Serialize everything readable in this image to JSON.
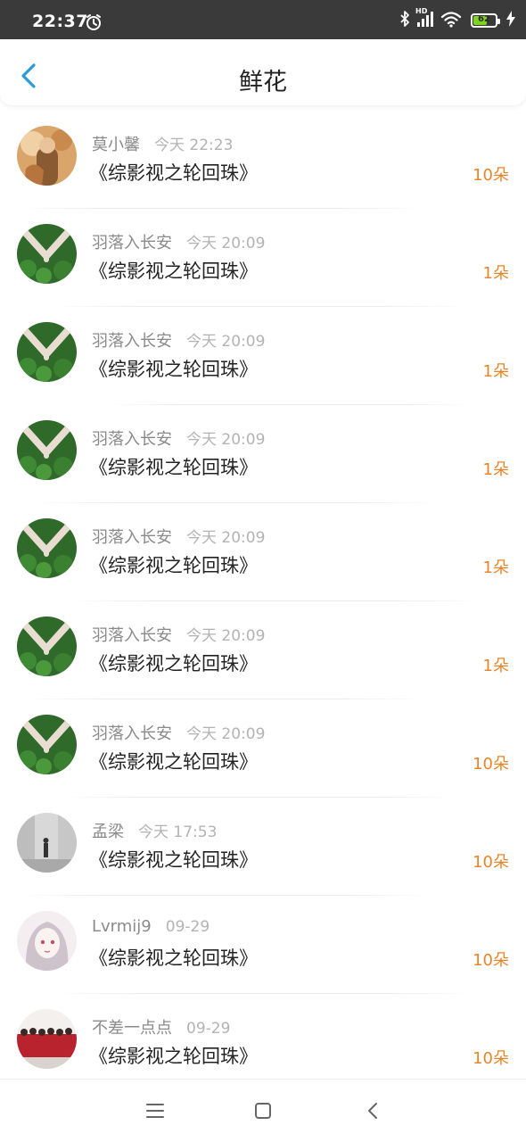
{
  "status_bar": {
    "time": "22:37",
    "hd_label": "HD",
    "battery_level": "62",
    "battery_percent": 62,
    "icons": [
      "alarm-icon",
      "bluetooth-icon",
      "signal-icon",
      "wifi-icon",
      "battery-icon",
      "charging-icon"
    ]
  },
  "header": {
    "title": "鲜花",
    "back_icon": "chevron-left-icon"
  },
  "colors": {
    "accent": "#2b9ad8",
    "amount": "#e8852a",
    "status_bar_bg": "#3a3a3a"
  },
  "items": [
    {
      "name": "莫小馨",
      "time": "今天 22:23",
      "title": "《综影视之轮回珠》",
      "amount": "10朵",
      "avatar": "warm-portrait"
    },
    {
      "name": "羽落入长安",
      "time": "今天 20:09",
      "title": "《综影视之轮回珠》",
      "amount": "1朵",
      "avatar": "heart-hands-grass"
    },
    {
      "name": "羽落入长安",
      "time": "今天 20:09",
      "title": "《综影视之轮回珠》",
      "amount": "1朵",
      "avatar": "heart-hands-grass"
    },
    {
      "name": "羽落入长安",
      "time": "今天 20:09",
      "title": "《综影视之轮回珠》",
      "amount": "1朵",
      "avatar": "heart-hands-grass"
    },
    {
      "name": "羽落入长安",
      "time": "今天 20:09",
      "title": "《综影视之轮回珠》",
      "amount": "1朵",
      "avatar": "heart-hands-grass"
    },
    {
      "name": "羽落入长安",
      "time": "今天 20:09",
      "title": "《综影视之轮回珠》",
      "amount": "1朵",
      "avatar": "heart-hands-grass"
    },
    {
      "name": "羽落入长安",
      "time": "今天 20:09",
      "title": "《综影视之轮回珠》",
      "amount": "10朵",
      "avatar": "heart-hands-grass"
    },
    {
      "name": "孟梁",
      "time": "今天 17:53",
      "title": "《综影视之轮回珠》",
      "amount": "10朵",
      "avatar": "grey-figure"
    },
    {
      "name": "Lvrmij9",
      "time": "09-29",
      "title": "《综影视之轮回珠》",
      "amount": "10朵",
      "avatar": "anime-girl"
    },
    {
      "name": "不差一点点",
      "time": "09-29",
      "title": "《综影视之轮回珠》",
      "amount": "10朵",
      "avatar": "group-red"
    }
  ],
  "system_nav": {
    "icons": [
      "menu-icon",
      "home-square-icon",
      "back-chevron-icon"
    ]
  }
}
